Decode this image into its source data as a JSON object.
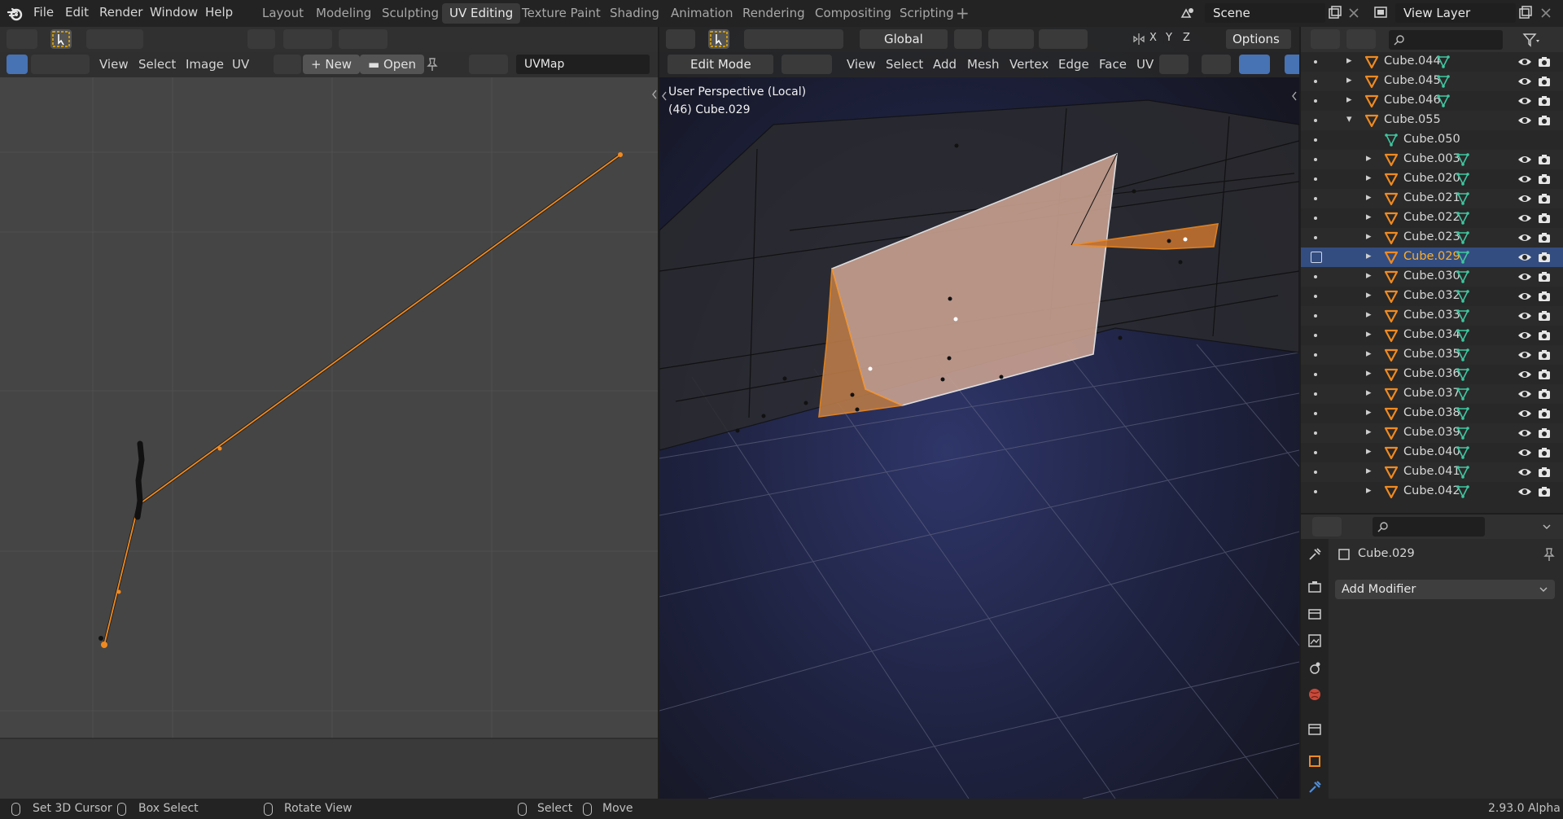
{
  "menu": [
    "File",
    "Edit",
    "Render",
    "Window",
    "Help"
  ],
  "workspaces": [
    "Layout",
    "Modeling",
    "Sculpting",
    "UV Editing",
    "Texture Paint",
    "Shading",
    "Animation",
    "Rendering",
    "Compositing",
    "Scripting"
  ],
  "active_workspace": "UV Editing",
  "scene_name": "Scene",
  "view_layer": "View Layer",
  "uv_editor": {
    "menu": [
      "View",
      "Select",
      "Image",
      "UV"
    ],
    "new_label": "New",
    "open_label": "Open",
    "uvmap": "UVMap"
  },
  "viewport": {
    "mode": "Edit Mode",
    "menu": [
      "View",
      "Select",
      "Add",
      "Mesh",
      "Vertex",
      "Edge",
      "Face",
      "UV"
    ],
    "orientation": "Global",
    "axes": [
      "X",
      "Y",
      "Z"
    ],
    "options_label": "Options",
    "overlay_title": "User Perspective (Local)",
    "overlay_object": "(46) Cube.029"
  },
  "outliner": {
    "rows": [
      {
        "name": "Cube.044",
        "level": 0
      },
      {
        "name": "Cube.045",
        "level": 0
      },
      {
        "name": "Cube.046",
        "level": 0
      },
      {
        "name": "Cube.055",
        "level": 0,
        "expanded": true
      },
      {
        "name": "Cube.050",
        "level": 1,
        "mesh": true
      },
      {
        "name": "Cube.003",
        "level": 1
      },
      {
        "name": "Cube.020",
        "level": 1
      },
      {
        "name": "Cube.021",
        "level": 1
      },
      {
        "name": "Cube.022",
        "level": 1
      },
      {
        "name": "Cube.023",
        "level": 1
      },
      {
        "name": "Cube.029",
        "level": 1,
        "selected": true
      },
      {
        "name": "Cube.030",
        "level": 1
      },
      {
        "name": "Cube.032",
        "level": 1
      },
      {
        "name": "Cube.033",
        "level": 1
      },
      {
        "name": "Cube.034",
        "level": 1
      },
      {
        "name": "Cube.035",
        "level": 1
      },
      {
        "name": "Cube.036",
        "level": 1
      },
      {
        "name": "Cube.037",
        "level": 1
      },
      {
        "name": "Cube.038",
        "level": 1
      },
      {
        "name": "Cube.039",
        "level": 1
      },
      {
        "name": "Cube.040",
        "level": 1
      },
      {
        "name": "Cube.041",
        "level": 1
      },
      {
        "name": "Cube.042",
        "level": 1
      }
    ]
  },
  "properties": {
    "object_name": "Cube.029",
    "add_modifier": "Add Modifier"
  },
  "statusbar": {
    "set_cursor": "Set 3D Cursor",
    "box_select": "Box Select",
    "rotate_view": "Rotate View",
    "select": "Select",
    "move": "Move",
    "version": "2.93.0 Alpha"
  },
  "colors": {
    "accent": "#4772b3",
    "selected_text": "#ffaf29",
    "selection_orange": "#f08a20",
    "mesh_green": "#3ec8a0"
  }
}
